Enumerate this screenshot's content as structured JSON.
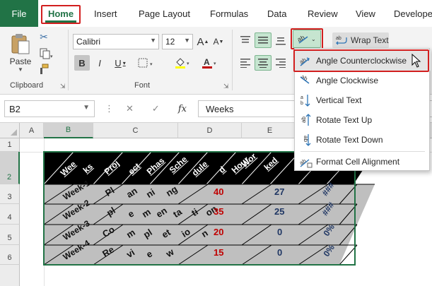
{
  "tabs": {
    "file": "File",
    "home": "Home",
    "insert": "Insert",
    "page_layout": "Page Layout",
    "formulas": "Formulas",
    "data": "Data",
    "review": "Review",
    "view": "View",
    "developer": "Develope"
  },
  "ribbon": {
    "clipboard": {
      "paste": "Paste",
      "label": "Clipboard"
    },
    "font": {
      "name": "Calibri",
      "size": "12",
      "grow": "A",
      "shrink": "A",
      "bold": "B",
      "italic": "I",
      "underline": "U",
      "label": "Font"
    },
    "alignment": {
      "wrap_text": "Wrap Text"
    }
  },
  "formula_bar": {
    "name_box": "B2",
    "fx": "fx",
    "value": "Weeks"
  },
  "grid": {
    "columns": [
      "A",
      "B",
      "C",
      "D",
      "E"
    ],
    "rows": [
      "1",
      "2",
      "3",
      "4",
      "5",
      "6"
    ],
    "header_fragments": [
      "Wee",
      "ks",
      "Proj",
      "ect",
      "Phas",
      "Sche",
      "dule",
      "d",
      "Hour",
      "Wor",
      "ked"
    ],
    "rows_data": [
      {
        "week": "Week-1",
        "phase_parts": [
          "Pl",
          "an",
          "ni",
          "ng"
        ],
        "scheduled": "40",
        "worked": "27",
        "pct": "###"
      },
      {
        "week": "Week-2",
        "phase_parts": [
          "pl",
          "e",
          "m",
          "en",
          "ta",
          "ti",
          "on"
        ],
        "scheduled": "35",
        "worked": "25",
        "pct": "###"
      },
      {
        "week": "Week-3",
        "phase_parts": [
          "Co",
          "m",
          "pl",
          "et",
          "io",
          "n"
        ],
        "scheduled": "20",
        "worked": "0",
        "pct": "0%"
      },
      {
        "week": "Week-4",
        "phase_parts": [
          "Re",
          "vi",
          "e",
          "w"
        ],
        "scheduled": "15",
        "worked": "0",
        "pct": "0%"
      }
    ]
  },
  "orientation_menu": {
    "items": [
      {
        "label": "Angle Counterclockwise",
        "icon": "angle-counterclockwise-icon",
        "highlighted": true
      },
      {
        "label": "Angle Clockwise",
        "icon": "angle-clockwise-icon",
        "highlighted": false
      },
      {
        "label": "Vertical Text",
        "icon": "vertical-text-icon",
        "highlighted": false
      },
      {
        "label": "Rotate Text Up",
        "icon": "rotate-text-up-icon",
        "highlighted": false
      },
      {
        "label": "Rotate Text Down",
        "icon": "rotate-text-down-icon",
        "highlighted": false
      },
      {
        "label": "Format Cell Alignment",
        "icon": "format-cell-alignment-icon",
        "highlighted": false
      }
    ]
  },
  "colors": {
    "excel_green": "#217346",
    "highlight_red": "#d21f1f",
    "font_red": "#c00000",
    "font_blue": "#203764",
    "cell_fill": "#bfbfbf",
    "header_fill": "#000000"
  }
}
